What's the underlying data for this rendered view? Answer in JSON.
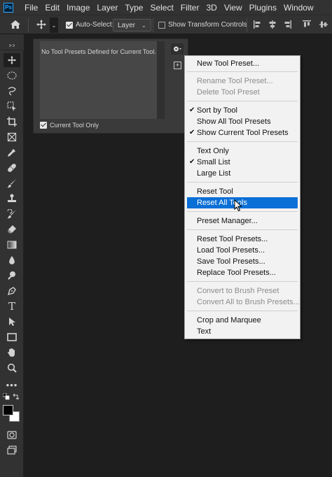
{
  "app": {
    "logo": "Ps"
  },
  "menubar": {
    "items": [
      "File",
      "Edit",
      "Image",
      "Layer",
      "Type",
      "Select",
      "Filter",
      "3D",
      "View",
      "Plugins",
      "Window"
    ]
  },
  "options_bar": {
    "auto_select_label": "Auto-Select:",
    "auto_select_checked": true,
    "layer_dropdown": "Layer",
    "show_transform_label": "Show Transform Controls",
    "show_transform_checked": false
  },
  "preset_panel": {
    "empty_message": "No Tool Presets Defined for Current Tool.",
    "current_tool_only_label": "Current Tool Only",
    "current_tool_only_checked": true
  },
  "context_menu": {
    "items": [
      {
        "label": "New Tool Preset...",
        "disabled": false,
        "checked": false
      },
      {
        "label": "Rename Tool Preset...",
        "disabled": true,
        "checked": false
      },
      {
        "label": "Delete Tool Preset",
        "disabled": true,
        "checked": false
      },
      {
        "label": "Sort by Tool",
        "disabled": false,
        "checked": true
      },
      {
        "label": "Show All Tool Presets",
        "disabled": false,
        "checked": false
      },
      {
        "label": "Show Current Tool Presets",
        "disabled": false,
        "checked": true
      },
      {
        "label": "Text Only",
        "disabled": false,
        "checked": false
      },
      {
        "label": "Small List",
        "disabled": false,
        "checked": true
      },
      {
        "label": "Large List",
        "disabled": false,
        "checked": false
      },
      {
        "label": "Reset Tool",
        "disabled": false,
        "checked": false
      },
      {
        "label": "Reset All Tools",
        "disabled": false,
        "checked": false,
        "highlighted": true
      },
      {
        "label": "Preset Manager...",
        "disabled": false,
        "checked": false
      },
      {
        "label": "Reset Tool Presets...",
        "disabled": false,
        "checked": false
      },
      {
        "label": "Load Tool Presets...",
        "disabled": false,
        "checked": false
      },
      {
        "label": "Save Tool Presets...",
        "disabled": false,
        "checked": false
      },
      {
        "label": "Replace Tool Presets...",
        "disabled": false,
        "checked": false
      },
      {
        "label": "Convert to Brush Preset",
        "disabled": true,
        "checked": false
      },
      {
        "label": "Convert All to Brush Presets...",
        "disabled": true,
        "checked": false
      },
      {
        "label": "Crop and Marquee",
        "disabled": false,
        "checked": false
      },
      {
        "label": "Text",
        "disabled": false,
        "checked": false
      }
    ]
  },
  "toolbar": {
    "tools": [
      "move-tool",
      "marquee-tool",
      "lasso-tool",
      "object-select-tool",
      "crop-tool",
      "frame-tool",
      "eyedropper-tool",
      "healing-brush-tool",
      "brush-tool",
      "clone-stamp-tool",
      "history-brush-tool",
      "eraser-tool",
      "gradient-tool",
      "blur-tool",
      "dodge-tool",
      "pen-tool",
      "type-tool",
      "path-selection-tool",
      "rectangle-tool",
      "hand-tool",
      "zoom-tool",
      "more-tools",
      "swap-default-colors",
      "color-swatches",
      "quick-mask",
      "screen-mode"
    ]
  },
  "colors": {
    "menu_highlight": "#0a6fd6",
    "panel_bg": "#323232",
    "canvas_bg": "#1e1e1e",
    "foreground_color": "#000000",
    "background_color": "#ffffff"
  }
}
